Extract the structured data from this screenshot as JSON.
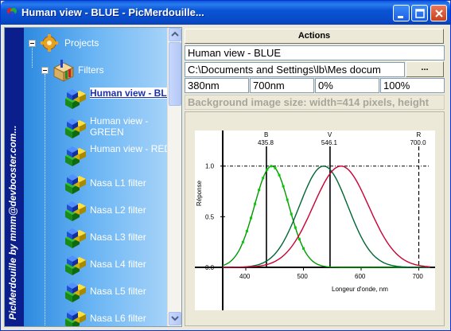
{
  "window": {
    "title": "Human view - BLUE  - PicMerdouille..."
  },
  "banner": {
    "text": "PicMerdouille by mmm@devbooster.com..."
  },
  "tree": {
    "projects_label": "Projects",
    "filters_label": "Filters",
    "items": [
      {
        "label": "Human view - BLUE",
        "selected": true
      },
      {
        "label": "Human view - GREEN",
        "selected": false
      },
      {
        "label": "Human view - RED",
        "selected": false
      },
      {
        "label": "Nasa L1 filter",
        "selected": false
      },
      {
        "label": "Nasa L2 filter",
        "selected": false
      },
      {
        "label": "Nasa L3 filter",
        "selected": false
      },
      {
        "label": "Nasa L4 filter",
        "selected": false
      },
      {
        "label": "Nasa L5 filter",
        "selected": false
      },
      {
        "label": "Nasa L6 filter",
        "selected": false
      }
    ]
  },
  "panel": {
    "actions_label": "Actions",
    "name_value": "Human view - BLUE",
    "path_value": "C:\\Documents and Settings\\lb\\Mes docum",
    "ellipsis_label": "...",
    "min_wavelength": "380nm",
    "max_wavelength": "700nm",
    "min_percent": "0%",
    "max_percent": "100%",
    "background_info": "Background image size: width=414 pixels, height"
  },
  "chart_data": {
    "type": "line",
    "xlabel": "Longeur d'onde, nm",
    "ylabel": "Réponse",
    "xlim": [
      360,
      720
    ],
    "ylim": [
      0,
      1.1
    ],
    "x_ticks": [
      400,
      500,
      600,
      700
    ],
    "y_ticks": [
      "0.0",
      "0.5",
      "1.0"
    ],
    "peak_labels": [
      {
        "letter": "B",
        "value": "435.8",
        "x": 435.8
      },
      {
        "letter": "V",
        "value": "546.1",
        "x": 546.1
      },
      {
        "letter": "R",
        "value": "700.0",
        "x": 700.0
      }
    ],
    "series": [
      {
        "color": "#009900",
        "peak": 445,
        "width": 30
      },
      {
        "color": "#006633",
        "peak": 535,
        "width": 42
      },
      {
        "color": "#cc0033",
        "peak": 565,
        "width": 48
      }
    ],
    "colors": {
      "blue_filter": "#00cc00",
      "green": "#006633",
      "red": "#cc0033"
    }
  }
}
